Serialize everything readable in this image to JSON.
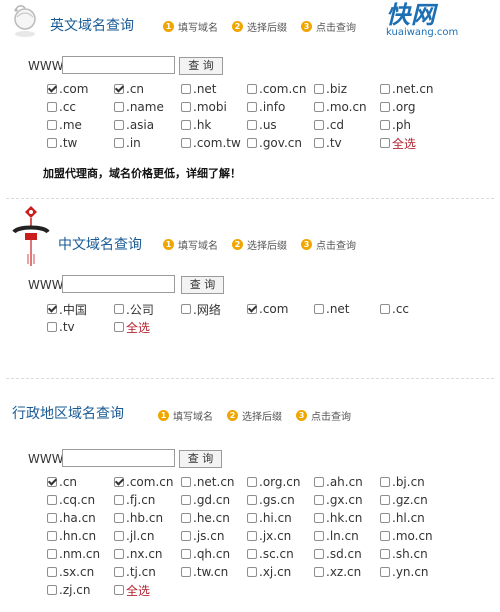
{
  "steps": [
    "填写域名",
    "选择后缀",
    "点击查询"
  ],
  "www_label": "WWW.",
  "query_label": "查 询",
  "select_all": "全选",
  "brand": {
    "logo_text": "快网",
    "site": "kuaiwang.com"
  },
  "english": {
    "title": "英文域名查询",
    "options": [
      {
        "label": ".com",
        "checked": true
      },
      {
        "label": ".cn",
        "checked": true
      },
      {
        "label": ".net",
        "checked": false
      },
      {
        "label": ".com.cn",
        "checked": false
      },
      {
        "label": ".biz",
        "checked": false
      },
      {
        "label": ".net.cn",
        "checked": false
      },
      {
        "label": ".cc",
        "checked": false
      },
      {
        "label": ".name",
        "checked": false
      },
      {
        "label": ".mobi",
        "checked": false
      },
      {
        "label": ".info",
        "checked": false
      },
      {
        "label": ".mo.cn",
        "checked": false
      },
      {
        "label": ".org",
        "checked": false
      },
      {
        "label": ".me",
        "checked": false
      },
      {
        "label": ".asia",
        "checked": false
      },
      {
        "label": ".hk",
        "checked": false
      },
      {
        "label": ".us",
        "checked": false
      },
      {
        "label": ".cd",
        "checked": false
      },
      {
        "label": ".ph",
        "checked": false
      },
      {
        "label": ".tw",
        "checked": false
      },
      {
        "label": ".in",
        "checked": false
      },
      {
        "label": ".com.tw",
        "checked": false
      },
      {
        "label": ".gov.cn",
        "checked": false
      },
      {
        "label": ".tv",
        "checked": false
      }
    ],
    "promo": "加盟代理商，域名价格更低，详细了解！"
  },
  "chinese": {
    "title": "中文域名查询",
    "options": [
      {
        "label": ".中国",
        "checked": true
      },
      {
        "label": ".公司",
        "checked": false
      },
      {
        "label": ".网络",
        "checked": false
      },
      {
        "label": ".com",
        "checked": true
      },
      {
        "label": ".net",
        "checked": false
      },
      {
        "label": ".cc",
        "checked": false
      },
      {
        "label": ".tv",
        "checked": false
      }
    ]
  },
  "regional": {
    "title": "行政地区域名查询",
    "options": [
      {
        "label": ".cn",
        "checked": true
      },
      {
        "label": ".com.cn",
        "checked": true
      },
      {
        "label": ".net.cn",
        "checked": false
      },
      {
        "label": ".org.cn",
        "checked": false
      },
      {
        "label": ".ah.cn",
        "checked": false
      },
      {
        "label": ".bj.cn",
        "checked": false
      },
      {
        "label": ".cq.cn",
        "checked": false
      },
      {
        "label": ".fj.cn",
        "checked": false
      },
      {
        "label": ".gd.cn",
        "checked": false
      },
      {
        "label": ".gs.cn",
        "checked": false
      },
      {
        "label": ".gx.cn",
        "checked": false
      },
      {
        "label": ".gz.cn",
        "checked": false
      },
      {
        "label": ".ha.cn",
        "checked": false
      },
      {
        "label": ".hb.cn",
        "checked": false
      },
      {
        "label": ".he.cn",
        "checked": false
      },
      {
        "label": ".hi.cn",
        "checked": false
      },
      {
        "label": ".hk.cn",
        "checked": false
      },
      {
        "label": ".hl.cn",
        "checked": false
      },
      {
        "label": ".hn.cn",
        "checked": false
      },
      {
        "label": ".jl.cn",
        "checked": false
      },
      {
        "label": ".js.cn",
        "checked": false
      },
      {
        "label": ".jx.cn",
        "checked": false
      },
      {
        "label": ".ln.cn",
        "checked": false
      },
      {
        "label": ".mo.cn",
        "checked": false
      },
      {
        "label": ".nm.cn",
        "checked": false
      },
      {
        "label": ".nx.cn",
        "checked": false
      },
      {
        "label": ".qh.cn",
        "checked": false
      },
      {
        "label": ".sc.cn",
        "checked": false
      },
      {
        "label": ".sd.cn",
        "checked": false
      },
      {
        "label": ".sh.cn",
        "checked": false
      },
      {
        "label": ".sx.cn",
        "checked": false
      },
      {
        "label": ".tj.cn",
        "checked": false
      },
      {
        "label": ".tw.cn",
        "checked": false
      },
      {
        "label": ".xj.cn",
        "checked": false
      },
      {
        "label": ".xz.cn",
        "checked": false
      },
      {
        "label": ".yn.cn",
        "checked": false
      },
      {
        "label": ".zj.cn",
        "checked": false
      }
    ]
  }
}
